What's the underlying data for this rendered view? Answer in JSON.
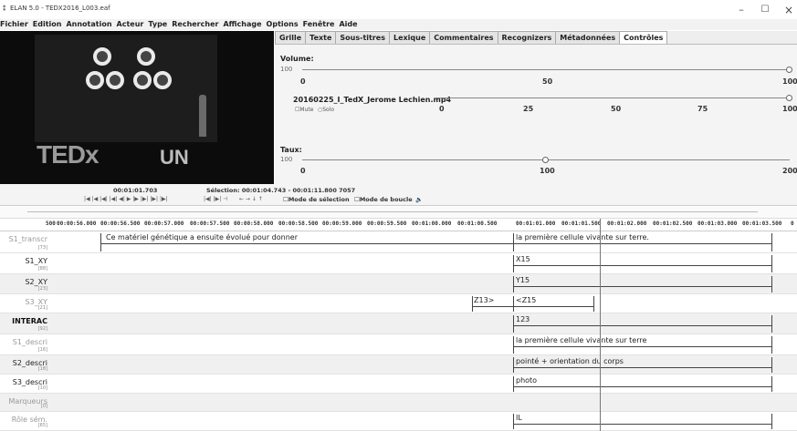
{
  "window": {
    "title": "ELAN 5.0 - TEDX2016_L003.eaf",
    "icon": "elan-icon",
    "min": "–",
    "max": "☐",
    "close": "×"
  },
  "menu": [
    "Fichier",
    "Edition",
    "Annotation",
    "Acteur",
    "Type",
    "Rechercher",
    "Affichage",
    "Options",
    "Fenêtre",
    "Aide"
  ],
  "tabs": [
    "Grille",
    "Texte",
    "Sous-titres",
    "Lexique",
    "Commentaires",
    "Recognizers",
    "Métadonnées",
    "Contrôles"
  ],
  "active_tab": "Contrôles",
  "controls": {
    "volume_label": "Volume:",
    "volume_value": "100",
    "volume_level": 1.0,
    "volume_ticks": [
      "0",
      "50",
      "100"
    ],
    "media_file": "20160225_I_TedX_Jerome Lechien.mp4",
    "media_level": 1.0,
    "mute_label": "Mute",
    "solo_label": "Solo",
    "media_ticks": [
      "0",
      "25",
      "50",
      "75",
      "100"
    ],
    "rate_label": "Taux:",
    "rate_value": "100",
    "rate_level": 0.5,
    "rate_ticks": [
      "0",
      "100",
      "200"
    ]
  },
  "player": {
    "time": "00:01:01.703",
    "selection": "Sélection: 00:01:04.743 - 00:01:11.800  7057",
    "buttons_left": "|◀ |◀ |◀| |◀| ◀| ▶ |▶ |▶| |▶| |▶|",
    "buttons_mid": "|◀| |▶| ⊣",
    "buttons_right": "← → ↓ ↑",
    "mode_selection": "Mode de sélection",
    "mode_loop": "Mode de boucle",
    "speaker_icon": "🔈"
  },
  "ruler": [
    "500",
    "00:00:56.000",
    "00:00:56.500",
    "00:00:57.000",
    "00:00:57.500",
    "00:00:58.000",
    "00:00:58.500",
    "00:00:59.000",
    "00:00:59.500",
    "00:01:00.000",
    "00:01:00.500",
    "00:01:01.000",
    "00:01:01.500",
    "00:01:02.000",
    "00:01:02.500",
    "00:01:03.000",
    "00:01:03.500",
    "0"
  ],
  "tiers": [
    {
      "name": "S1_transcr",
      "count": "[73]",
      "style": "dim",
      "annotations": [
        {
          "text": "Ce matériel génétique a ensuite évolué pour donner"
        },
        {
          "text": "la première cellule vivante sur terre."
        }
      ]
    },
    {
      "name": "S1_XY",
      "count": "[88]",
      "style": "normal",
      "annotations": [
        {
          "text": "X15"
        }
      ]
    },
    {
      "name": "S2_XY",
      "count": "[23]",
      "style": "normal",
      "annotations": [
        {
          "text": "Y15"
        }
      ]
    },
    {
      "name": "S3_XY",
      "count": "[21]",
      "style": "dim",
      "annotations": [
        {
          "text": "Z13>"
        },
        {
          "text": "<Z15"
        }
      ]
    },
    {
      "name": "INTERAC",
      "count": "[92]",
      "style": "bold",
      "annotations": [
        {
          "text": "123"
        }
      ]
    },
    {
      "name": "S1_descri",
      "count": "[16]",
      "style": "dim",
      "annotations": [
        {
          "text": "la première cellule vivante sur terre"
        }
      ]
    },
    {
      "name": "S2_descri",
      "count": "[18]",
      "style": "normal",
      "annotations": [
        {
          "text": "pointé + orientation du corps"
        }
      ]
    },
    {
      "name": "S3_descri",
      "count": "[10]",
      "style": "normal",
      "annotations": [
        {
          "text": "photo"
        }
      ]
    },
    {
      "name": "Marqueurs",
      "count": "[0]",
      "style": "dim",
      "annotations": []
    },
    {
      "name": "Rôle sém.",
      "count": "[65]",
      "style": "dim",
      "annotations": [
        {
          "text": "IL"
        }
      ]
    }
  ],
  "video": {
    "stage_text": "TEDx",
    "stage_sub": "UN"
  }
}
